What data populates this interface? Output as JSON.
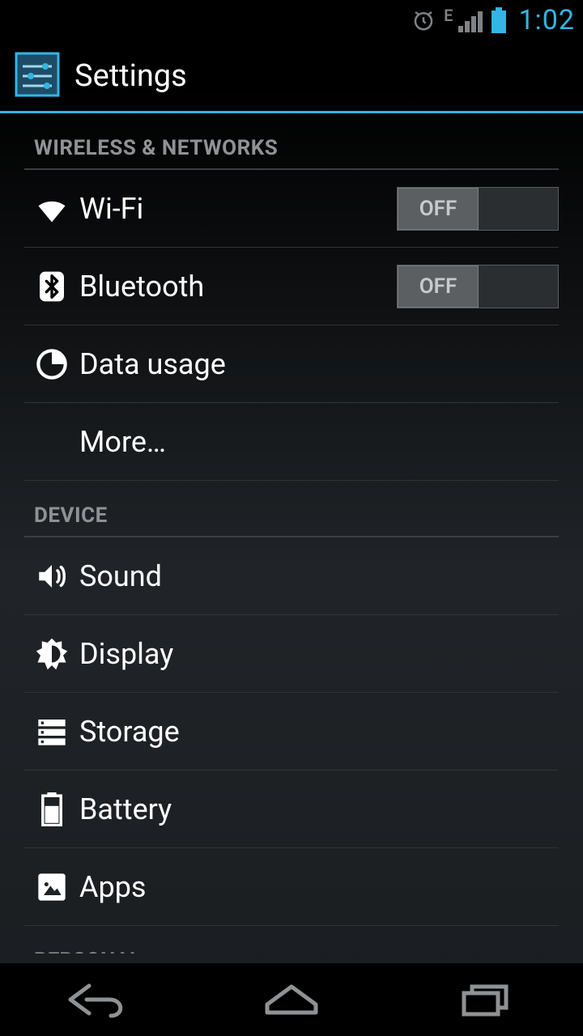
{
  "status": {
    "network_type": "E",
    "time": "1:02"
  },
  "app_bar": {
    "title": "Settings"
  },
  "sections": {
    "wireless": {
      "header": "WIRELESS & NETWORKS",
      "wifi_label": "Wi-Fi",
      "wifi_toggle": "OFF",
      "bluetooth_label": "Bluetooth",
      "bluetooth_toggle": "OFF",
      "data_usage_label": "Data usage",
      "more_label": "More…"
    },
    "device": {
      "header": "DEVICE",
      "sound_label": "Sound",
      "display_label": "Display",
      "storage_label": "Storage",
      "battery_label": "Battery",
      "apps_label": "Apps"
    },
    "personal": {
      "header": "PERSONAL"
    }
  }
}
